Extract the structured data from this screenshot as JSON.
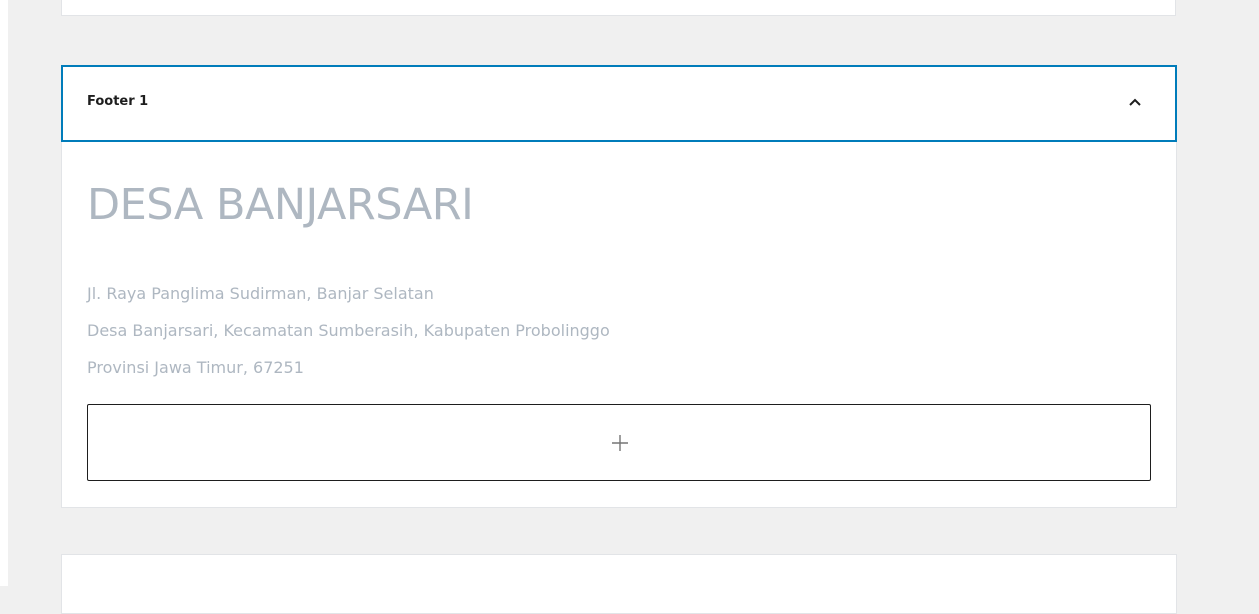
{
  "panel": {
    "title": "Footer 1",
    "toggle_icon": "chevron-up-icon",
    "expanded": true
  },
  "content": {
    "site_name": "DESA BANJARSARI",
    "address_lines": [
      "Jl. Raya Panglima Sudirman, Banjar Selatan",
      "Desa Banjarsari, Kecamatan Sumberasih, Kabupaten Probolinggo",
      "Provinsi Jawa Timur, 67251"
    ]
  },
  "block_appender": {
    "icon": "plus-icon"
  },
  "colors": {
    "background": "#f0f0f0",
    "panel": "#ffffff",
    "focus_border": "#007cba",
    "muted_text": "#aeb7c1",
    "title_text": "#1e1e1e"
  }
}
